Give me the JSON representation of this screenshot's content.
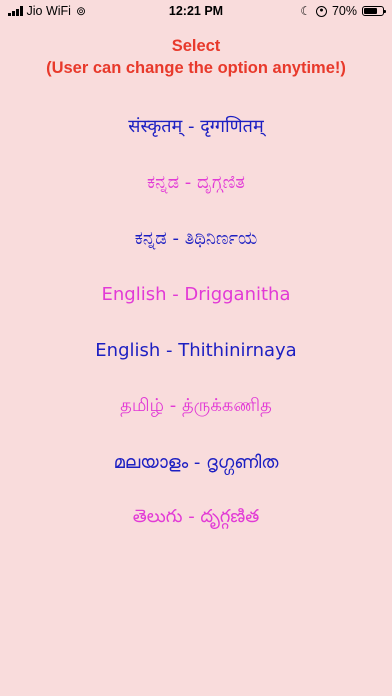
{
  "status_bar": {
    "carrier": "Jio WiFi",
    "time": "12:21 PM",
    "battery": "70%",
    "battery_level": 0.7,
    "icons": [
      "signal-icon",
      "link-icon",
      "moon-icon",
      "rotation-lock-icon",
      "battery-icon"
    ]
  },
  "header": {
    "line1": "Select",
    "line2": "(User can change the option anytime!)",
    "color": "#e8392b"
  },
  "colors": {
    "background": "#f9dcdc",
    "blue": "#1c1fc2",
    "pink": "#e23ad6"
  },
  "options": [
    {
      "label": "संस्कृतम् - दृग्गणितम्",
      "color": "blue"
    },
    {
      "label": "ಕನ್ನಡ - ದೃಗ್ಗಣಿತ",
      "color": "pink"
    },
    {
      "label": "ಕನ್ನಡ - ತಿಥಿನಿರ್ಣಯ",
      "color": "blue"
    },
    {
      "label": "English - Drigganitha",
      "color": "pink"
    },
    {
      "label": "English - Thithinirnaya",
      "color": "blue"
    },
    {
      "label": "தமிழ் - த்ருக்கணித",
      "color": "pink"
    },
    {
      "label": "മലയാളം - ദൃഗ്ഗണിത",
      "color": "blue"
    },
    {
      "label": "తెలుగు - దృగ్గణిత",
      "color": "pink"
    }
  ]
}
